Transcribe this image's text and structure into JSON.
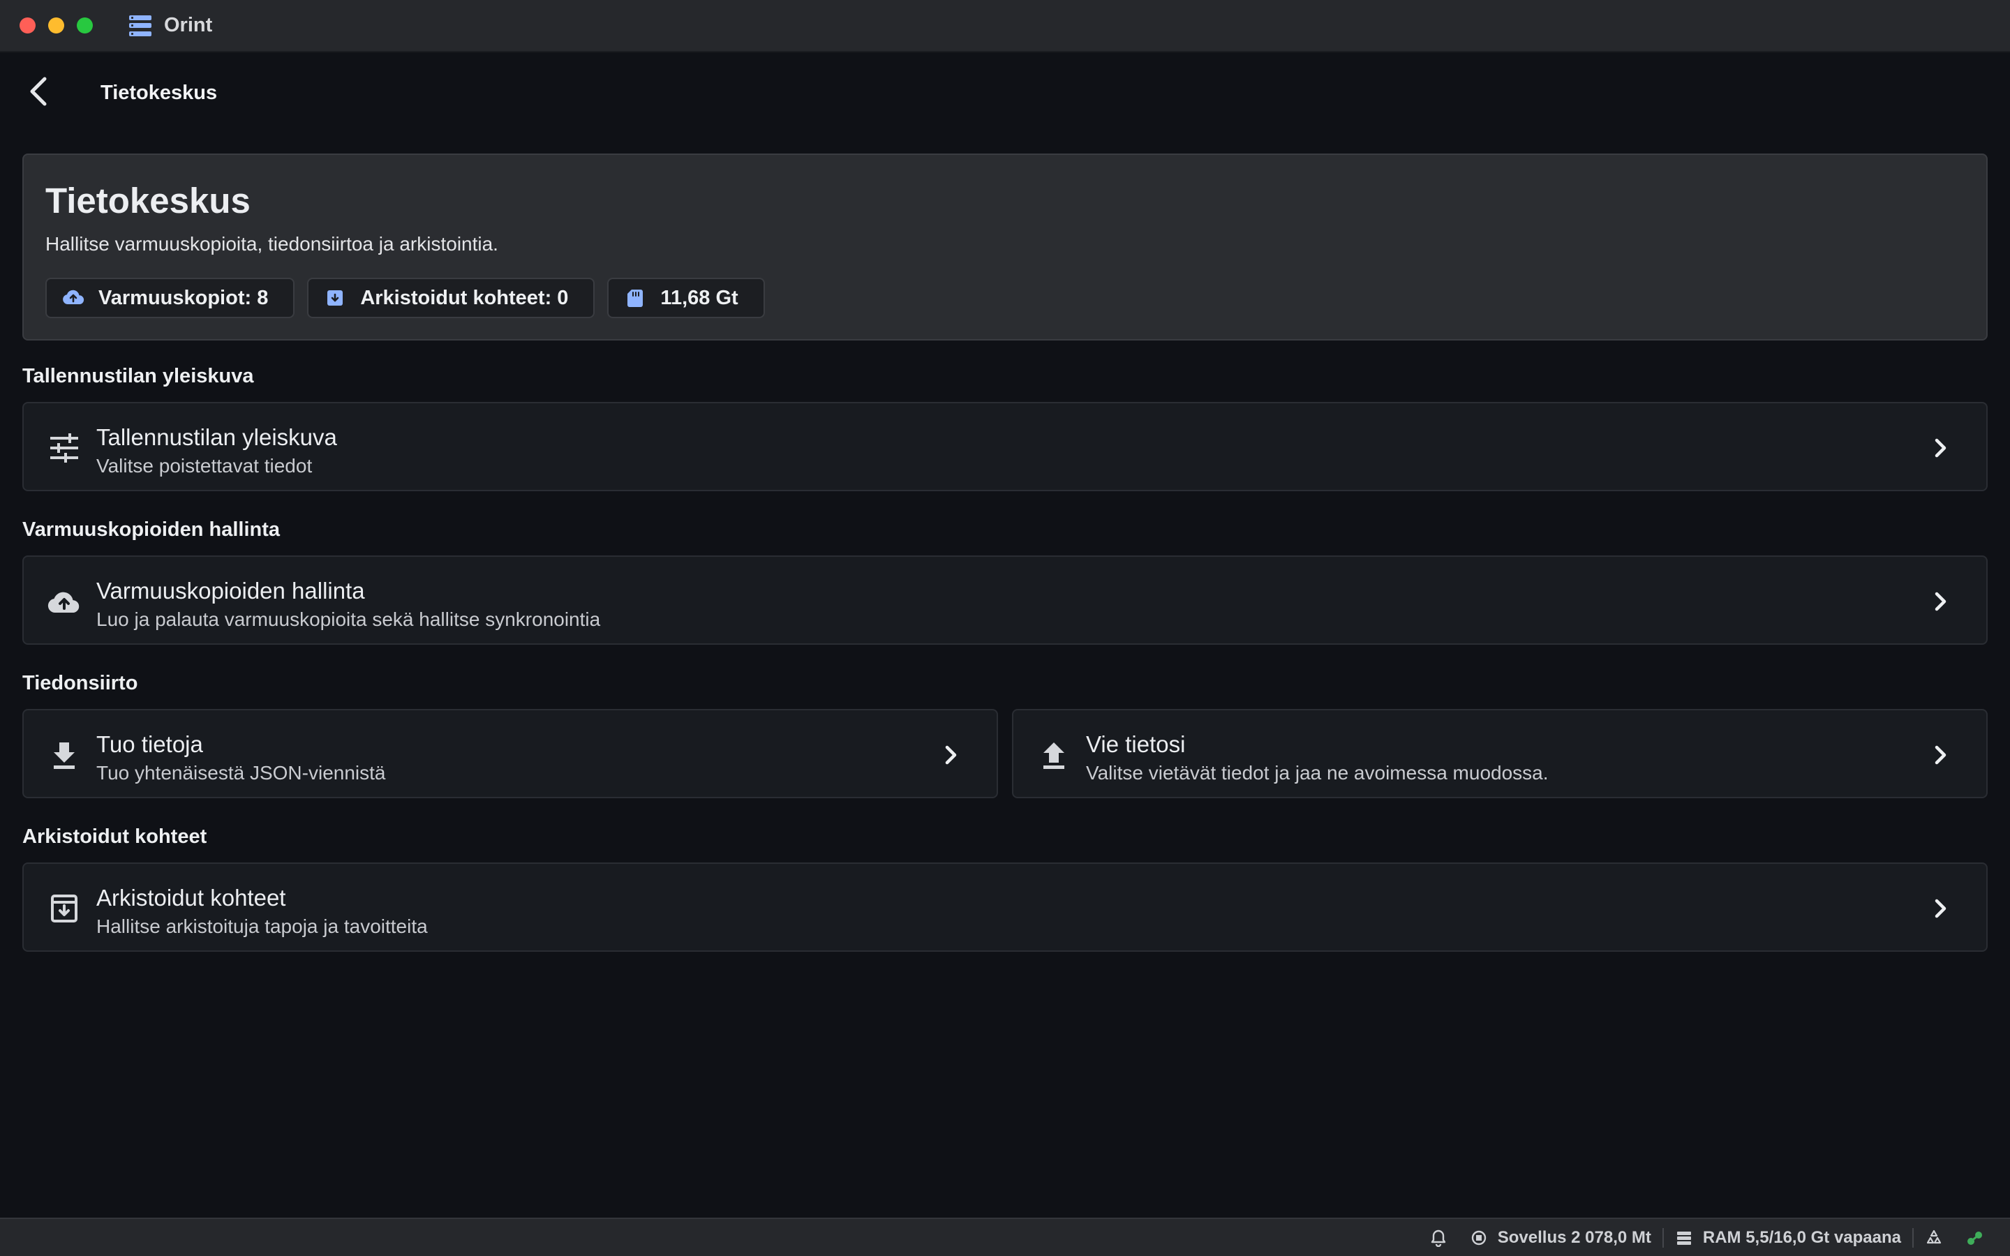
{
  "window": {
    "app_title": "Orint"
  },
  "navbar": {
    "title": "Tietokeskus"
  },
  "hero": {
    "title": "Tietokeskus",
    "subtitle": "Hallitse varmuuskopioita, tiedonsiirtoa ja arkistointia.",
    "chips": [
      {
        "label": "Varmuuskopiot: 8",
        "icon": "cloud-upload-icon"
      },
      {
        "label": "Arkistoidut kohteet: 0",
        "icon": "archive-icon"
      },
      {
        "label": "11,68 Gt",
        "icon": "sd-card-icon"
      }
    ]
  },
  "sections": {
    "storage": {
      "label": "Tallennustilan yleiskuva",
      "card": {
        "title": "Tallennustilan yleiskuva",
        "subtitle": "Valitse poistettavat tiedot",
        "icon": "tune-icon"
      }
    },
    "backup": {
      "label": "Varmuuskopioiden hallinta",
      "card": {
        "title": "Varmuuskopioiden hallinta",
        "subtitle": "Luo ja palauta varmuuskopioita sekä hallitse synkronointia",
        "icon": "cloud-upload-icon"
      }
    },
    "transfer": {
      "label": "Tiedonsiirto",
      "import": {
        "title": "Tuo tietoja",
        "subtitle": "Tuo yhtenäisestä JSON-viennistä",
        "icon": "download-icon"
      },
      "export": {
        "title": "Vie tietosi",
        "subtitle": "Valitse vietävät tiedot ja jaa ne avoimessa muodossa.",
        "icon": "upload-icon"
      }
    },
    "archived": {
      "label": "Arkistoidut kohteet",
      "card": {
        "title": "Arkistoidut kohteet",
        "subtitle": "Hallitse arkistoituja tapoja ja tavoitteita",
        "icon": "archive-icon"
      }
    }
  },
  "statusbar": {
    "app_memory": "Sovellus 2 078,0 Mt",
    "ram": "RAM 5,5/16,0 Gt vapaana"
  },
  "colors": {
    "background": "#0f1116",
    "card": "#181b20",
    "hero": "#2b2d31",
    "accent_icon": "#8fb4ff",
    "status_green": "#3fae5a"
  }
}
